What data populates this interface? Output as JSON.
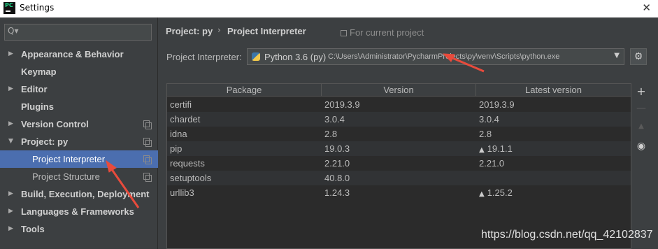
{
  "window": {
    "title": "Settings",
    "logo_text": "PC",
    "close_glyph": "✕",
    "logo_icon": "pycharm-logo-icon"
  },
  "search": {
    "placeholder": "",
    "icon_glyph": "Q▾"
  },
  "sidebar": {
    "items": [
      {
        "label": "Appearance & Behavior",
        "arrow": "▶",
        "copy": false
      },
      {
        "label": "Keymap",
        "arrow": "",
        "copy": false
      },
      {
        "label": "Editor",
        "arrow": "▶",
        "copy": false
      },
      {
        "label": "Plugins",
        "arrow": "",
        "copy": false
      },
      {
        "label": "Version Control",
        "arrow": "▶",
        "copy": true
      },
      {
        "label": "Project: py",
        "arrow": "▼",
        "copy": true
      },
      {
        "label": "Project Interpreter",
        "arrow": "",
        "copy": true,
        "selected": true
      },
      {
        "label": "Project Structure",
        "arrow": "",
        "copy": true
      },
      {
        "label": "Build, Execution, Deployment",
        "arrow": "▶",
        "copy": false
      },
      {
        "label": "Languages & Frameworks",
        "arrow": "▶",
        "copy": false
      },
      {
        "label": "Tools",
        "arrow": "▶",
        "copy": false
      }
    ]
  },
  "breadcrumb": {
    "project": "Project: py",
    "separator": "›",
    "page": "Project Interpreter",
    "scope": "For current project"
  },
  "interpreter": {
    "label": "Project Interpreter:",
    "name": "Python 3.6 (py)",
    "path": "C:\\Users\\Administrator\\PycharmProjects\\py\\venv\\Scripts\\python.exe",
    "caret": "▼",
    "settings_glyph": "⚙"
  },
  "packages": {
    "columns": [
      "Package",
      "Version",
      "Latest version"
    ],
    "rows": [
      {
        "package": "certifi",
        "version": "2019.3.9",
        "latest": "2019.3.9",
        "upgrade": false
      },
      {
        "package": "chardet",
        "version": "3.0.4",
        "latest": "3.0.4",
        "upgrade": false
      },
      {
        "package": "idna",
        "version": "2.8",
        "latest": "2.8",
        "upgrade": false
      },
      {
        "package": "pip",
        "version": "19.0.3",
        "latest": "19.1.1",
        "upgrade": true
      },
      {
        "package": "requests",
        "version": "2.21.0",
        "latest": "2.21.0",
        "upgrade": false
      },
      {
        "package": "setuptools",
        "version": "40.8.0",
        "latest": "",
        "upgrade": false
      },
      {
        "package": "urllib3",
        "version": "1.24.3",
        "latest": "1.25.2",
        "upgrade": true
      }
    ],
    "upgrade_glyph": "▲"
  },
  "toolbar": {
    "add_glyph": "+",
    "remove_glyph": "—",
    "upgrade_glyph": "▲",
    "show_glyph": "◉"
  },
  "watermark": "https://blog.csdn.net/qq_42102837",
  "colors": {
    "background": "#3c3f41",
    "selection": "#4b6eaf",
    "annotation_arrow": "#e84b3c"
  }
}
